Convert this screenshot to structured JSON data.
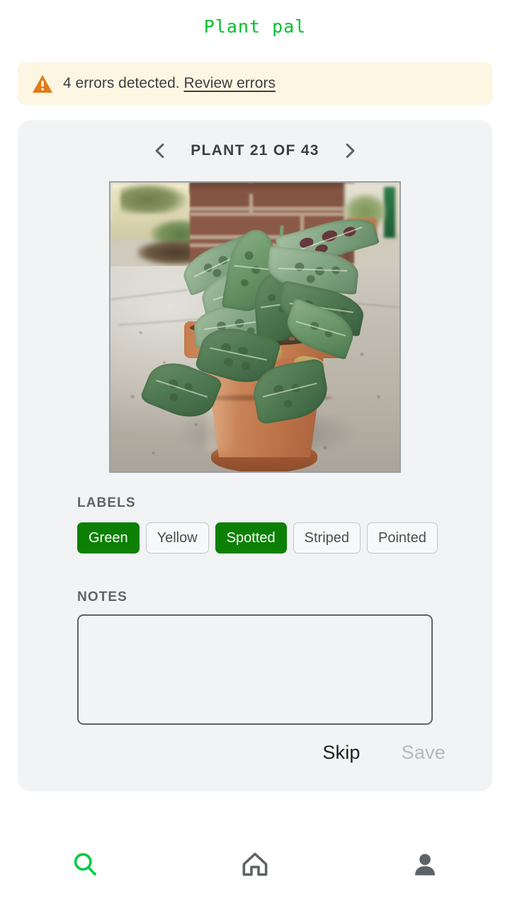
{
  "app": {
    "title": "Plant pal",
    "title_color": "#00bf30"
  },
  "banner": {
    "icon": "warning-triangle-icon",
    "message": "4 errors detected.",
    "link_label": "Review errors",
    "background_color": "#fdf6e3",
    "icon_color": "#e07b16"
  },
  "pager": {
    "prev_icon": "chevron-left-icon",
    "next_icon": "chevron-right-icon",
    "label": "PLANT 21 OF 43",
    "current": 21,
    "total": 43
  },
  "photo": {
    "alt": "Potted prayer plant on concrete patio in front of brick wall"
  },
  "labels": {
    "heading": "LABELS",
    "selected_color": "#0c8005",
    "chips": [
      {
        "label": "Green",
        "selected": true
      },
      {
        "label": "Yellow",
        "selected": false
      },
      {
        "label": "Spotted",
        "selected": true
      },
      {
        "label": "Striped",
        "selected": false
      },
      {
        "label": "Pointed",
        "selected": false
      }
    ]
  },
  "notes": {
    "heading": "NOTES",
    "value": "",
    "placeholder": ""
  },
  "actions": {
    "skip_label": "Skip",
    "save_label": "Save",
    "save_disabled": true
  },
  "bottom_nav": {
    "items": [
      {
        "icon": "search-icon",
        "active": true,
        "color": "#00c943"
      },
      {
        "icon": "home-icon",
        "active": false,
        "color": "#5f6368"
      },
      {
        "icon": "person-icon",
        "active": false,
        "color": "#5f6368"
      }
    ]
  }
}
